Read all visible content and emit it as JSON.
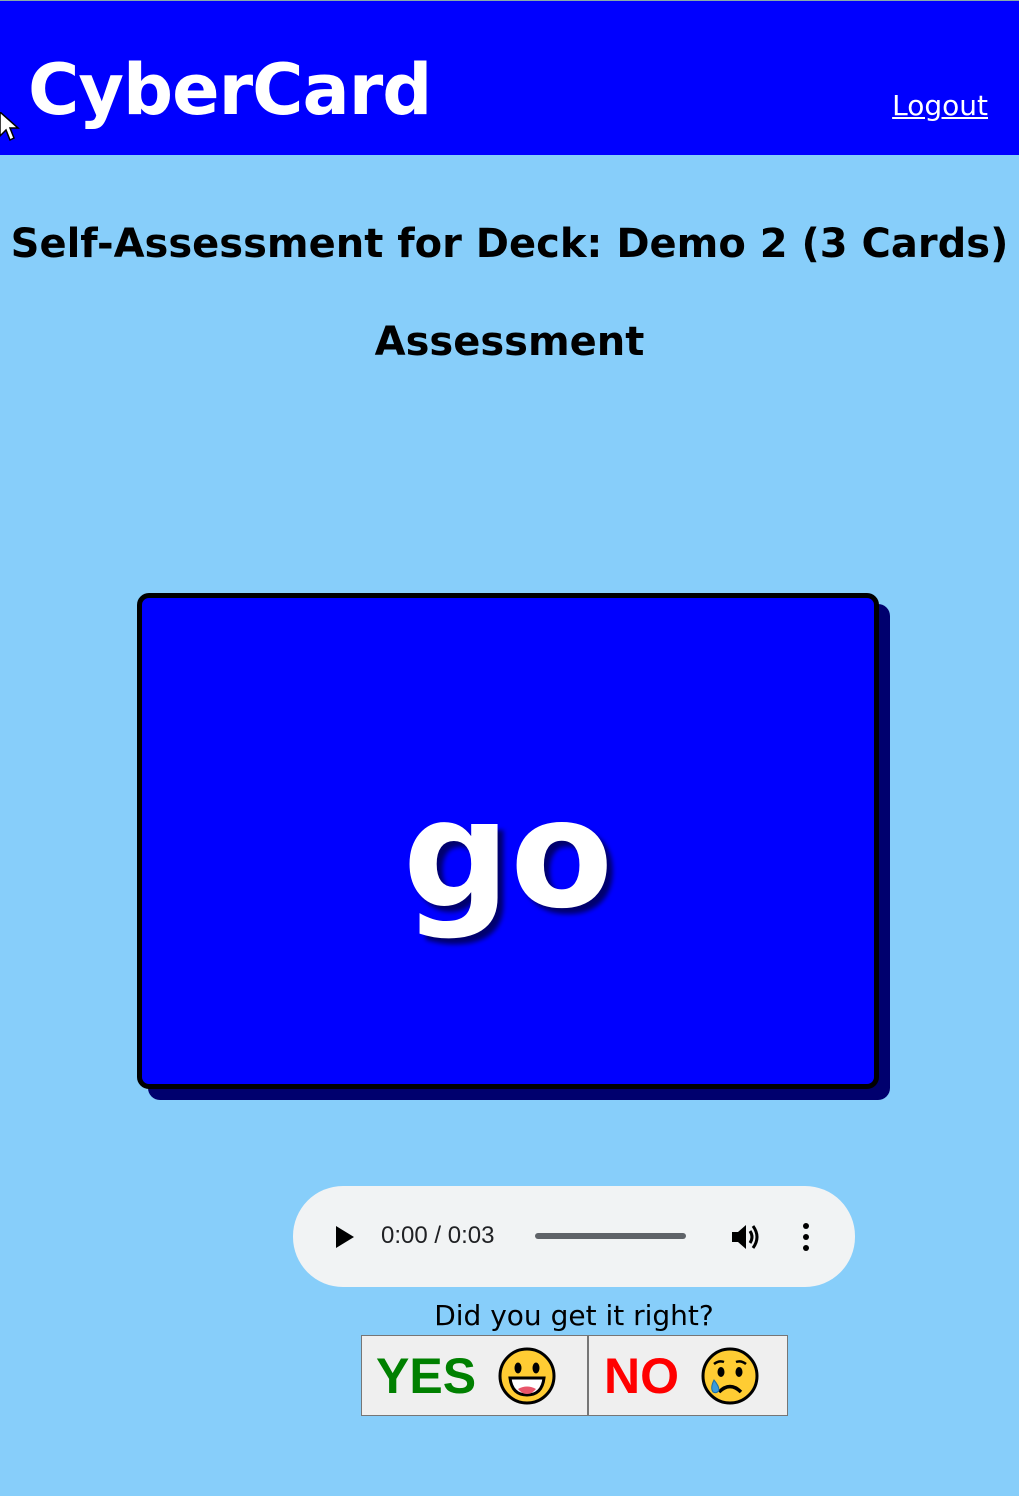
{
  "header": {
    "brand": "CyberCard",
    "logout_label": "Logout"
  },
  "page": {
    "title": "Self-Assessment for Deck: Demo 2 (3 Cards)",
    "section_title": "Assessment"
  },
  "card": {
    "word": "go"
  },
  "audio": {
    "time": "0:00 / 0:03",
    "icons": [
      "play-icon",
      "volume-icon",
      "more-options-icon"
    ]
  },
  "assessment": {
    "prompt": "Did you get it right?",
    "yes_label": "YES",
    "no_label": "NO",
    "yes_emoji": "grinning-face",
    "no_emoji": "crying-face"
  },
  "colors": {
    "header": "#0000ff",
    "background": "#87cefa",
    "card": "#0000ff",
    "card_shadow": "#00006e",
    "yes": "#008000",
    "no": "#ff0000"
  }
}
